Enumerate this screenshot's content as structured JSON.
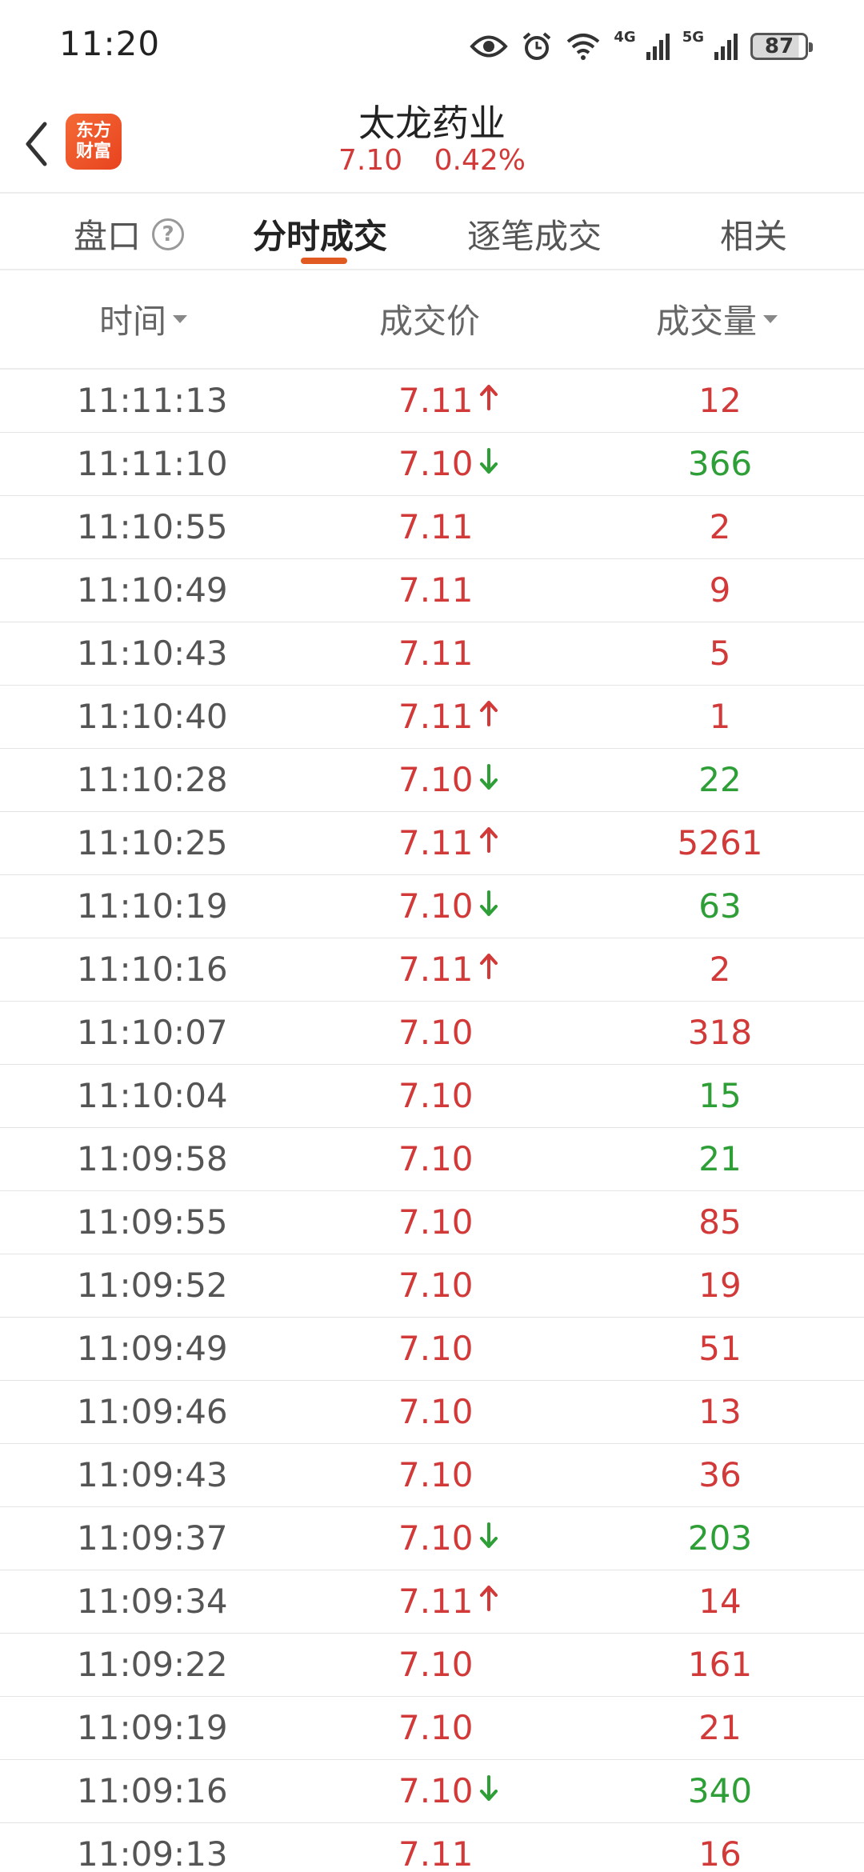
{
  "status_bar": {
    "time": "11:20",
    "network_4g": "4G",
    "network_5g": "5G",
    "battery": "87"
  },
  "header": {
    "logo_line1": "东方",
    "logo_line2": "财富",
    "stock_name": "太龙药业",
    "price": "7.10",
    "change_pct": "0.42%"
  },
  "tabs": [
    {
      "label": "盘口"
    },
    {
      "label": "分时成交"
    },
    {
      "label": "逐笔成交"
    },
    {
      "label": "相关"
    }
  ],
  "columns": {
    "time": "时间",
    "price": "成交价",
    "volume": "成交量"
  },
  "colors": {
    "up": "#d23a3a",
    "down": "#2e9e37",
    "accent": "#e05a22"
  },
  "trades": [
    {
      "time": "11:11:13",
      "price": "7.11",
      "dir": "up",
      "volume": "12",
      "vol_color": "red"
    },
    {
      "time": "11:11:10",
      "price": "7.10",
      "dir": "down",
      "volume": "366",
      "vol_color": "green"
    },
    {
      "time": "11:10:55",
      "price": "7.11",
      "dir": "",
      "volume": "2",
      "vol_color": "red"
    },
    {
      "time": "11:10:49",
      "price": "7.11",
      "dir": "",
      "volume": "9",
      "vol_color": "red"
    },
    {
      "time": "11:10:43",
      "price": "7.11",
      "dir": "",
      "volume": "5",
      "vol_color": "red"
    },
    {
      "time": "11:10:40",
      "price": "7.11",
      "dir": "up",
      "volume": "1",
      "vol_color": "red"
    },
    {
      "time": "11:10:28",
      "price": "7.10",
      "dir": "down",
      "volume": "22",
      "vol_color": "green"
    },
    {
      "time": "11:10:25",
      "price": "7.11",
      "dir": "up",
      "volume": "5261",
      "vol_color": "red"
    },
    {
      "time": "11:10:19",
      "price": "7.10",
      "dir": "down",
      "volume": "63",
      "vol_color": "green"
    },
    {
      "time": "11:10:16",
      "price": "7.11",
      "dir": "up",
      "volume": "2",
      "vol_color": "red"
    },
    {
      "time": "11:10:07",
      "price": "7.10",
      "dir": "",
      "volume": "318",
      "vol_color": "red"
    },
    {
      "time": "11:10:04",
      "price": "7.10",
      "dir": "",
      "volume": "15",
      "vol_color": "green"
    },
    {
      "time": "11:09:58",
      "price": "7.10",
      "dir": "",
      "volume": "21",
      "vol_color": "green"
    },
    {
      "time": "11:09:55",
      "price": "7.10",
      "dir": "",
      "volume": "85",
      "vol_color": "red"
    },
    {
      "time": "11:09:52",
      "price": "7.10",
      "dir": "",
      "volume": "19",
      "vol_color": "red"
    },
    {
      "time": "11:09:49",
      "price": "7.10",
      "dir": "",
      "volume": "51",
      "vol_color": "red"
    },
    {
      "time": "11:09:46",
      "price": "7.10",
      "dir": "",
      "volume": "13",
      "vol_color": "red"
    },
    {
      "time": "11:09:43",
      "price": "7.10",
      "dir": "",
      "volume": "36",
      "vol_color": "red"
    },
    {
      "time": "11:09:37",
      "price": "7.10",
      "dir": "down",
      "volume": "203",
      "vol_color": "green"
    },
    {
      "time": "11:09:34",
      "price": "7.11",
      "dir": "up",
      "volume": "14",
      "vol_color": "red"
    },
    {
      "time": "11:09:22",
      "price": "7.10",
      "dir": "",
      "volume": "161",
      "vol_color": "red"
    },
    {
      "time": "11:09:19",
      "price": "7.10",
      "dir": "",
      "volume": "21",
      "vol_color": "red"
    },
    {
      "time": "11:09:16",
      "price": "7.10",
      "dir": "down",
      "volume": "340",
      "vol_color": "green"
    },
    {
      "time": "11:09:13",
      "price": "7.11",
      "dir": "",
      "volume": "16",
      "vol_color": "red"
    }
  ]
}
